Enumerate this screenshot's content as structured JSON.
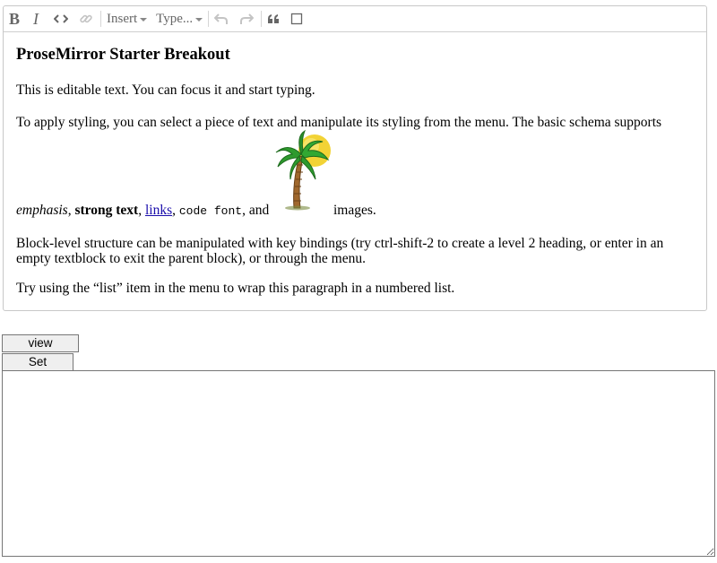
{
  "toolbar": {
    "insert_label": "Insert",
    "type_label": "Type..."
  },
  "document": {
    "title": "ProseMirror Starter Breakout",
    "p1": "This is editable text. You can focus it and start typing.",
    "p2_text": "To apply styling, you can select a piece of text and manipulate its styling from the menu. The basic schema supports",
    "p2_em": "emphasis",
    "p2_sep1": ", ",
    "p2_strong": "strong text",
    "p2_sep2": ", ",
    "p2_link": "links",
    "p2_sep3": ", ",
    "p2_code": "code font",
    "p2_sep4": ", and",
    "p2_after": "images.",
    "p3": "Block-level structure can be manipulated with key bindings (try ctrl-shift-2 to create a level 2 heading, or enter in an empty textblock to exit the parent block), or through the menu.",
    "p4": "Try using the “list” item in the menu to wrap this paragraph in a numbered list."
  },
  "buttons": {
    "view_source": "view source",
    "set_source": "Set source"
  },
  "source_textarea": {
    "value": ""
  }
}
